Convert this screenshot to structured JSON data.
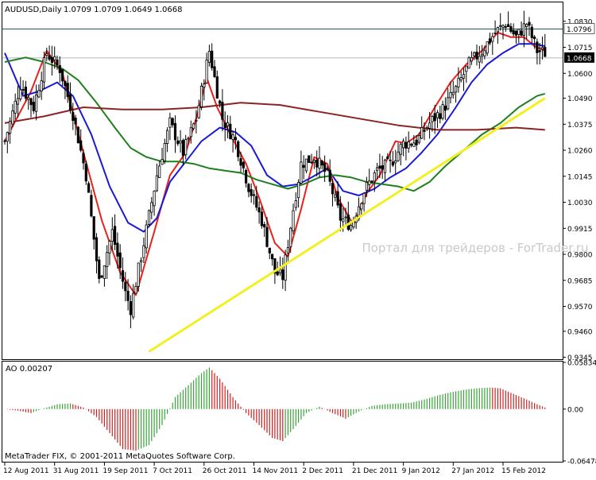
{
  "header": {
    "symbol": "AUDUSD,Daily",
    "ohlc": "1.0709 1.0709 1.0649 1.0668"
  },
  "watermark": "Портал для трейдеров - ForTrader.ru",
  "copyright": "MetaTrader FIX, © 2001-2011 MetaQuotes Software Corp.",
  "colors": {
    "candles": "#000000",
    "ma_red": "#e8211b",
    "ma_blue": "#1a1ad6",
    "ma_green": "#1e7f1e",
    "ma_brown": "#8b2323",
    "trendline": "#f2ef22",
    "ao_up": "#3aa33a",
    "ao_down": "#d11f1f",
    "level_line": "#1a5a5a",
    "watermark": "#c9c9c9"
  },
  "chart_data": [
    {
      "type": "candlestick",
      "instrument": "AUDUSD",
      "timeframe": "Daily",
      "ylim": [
        0.934,
        1.091
      ],
      "y_ticks": [
        "1.0830",
        "1.0715",
        "1.0600",
        "1.0490",
        "1.0375",
        "1.0260",
        "1.0145",
        "1.0030",
        "0.9915",
        "0.9800",
        "0.9685",
        "0.9570",
        "0.9460",
        "0.9345"
      ],
      "x_ticks": [
        "12 Aug 2011",
        "31 Aug 2011",
        "19 Sep 2011",
        "7 Oct 2011",
        "26 Oct 2011",
        "14 Nov 2011",
        "2 Dec 2011",
        "21 Dec 2011",
        "9 Jan 2012",
        "27 Jan 2012",
        "15 Feb 2012"
      ],
      "price_labels": {
        "level": "1.0796",
        "current": "1.0668"
      },
      "horizontal_level": 1.0796,
      "current_price": 1.0668,
      "close_path": [
        [
          0,
          1.03
        ],
        [
          6,
          1.055
        ],
        [
          11,
          1.045
        ],
        [
          16,
          1.069
        ],
        [
          21,
          1.062
        ],
        [
          26,
          1.042
        ],
        [
          31,
          1.015
        ],
        [
          36,
          0.968
        ],
        [
          41,
          0.99
        ],
        [
          46,
          0.963
        ],
        [
          48,
          0.956
        ],
        [
          53,
          0.985
        ],
        [
          58,
          1.015
        ],
        [
          63,
          1.038
        ],
        [
          68,
          1.025
        ],
        [
          73,
          1.04
        ],
        [
          78,
          1.07
        ],
        [
          83,
          1.04
        ],
        [
          88,
          1.03
        ],
        [
          93,
          1.01
        ],
        [
          98,
          0.995
        ],
        [
          103,
          0.972
        ],
        [
          106,
          0.97
        ],
        [
          110,
          1.0
        ],
        [
          113,
          1.02
        ],
        [
          118,
          1.023
        ],
        [
          123,
          1.015
        ],
        [
          128,
          0.996
        ],
        [
          132,
          0.993
        ],
        [
          137,
          1.008
        ],
        [
          142,
          1.017
        ],
        [
          147,
          1.02
        ],
        [
          152,
          1.029
        ],
        [
          157,
          1.03
        ],
        [
          162,
          1.038
        ],
        [
          167,
          1.044
        ],
        [
          172,
          1.053
        ],
        [
          177,
          1.064
        ],
        [
          182,
          1.07
        ],
        [
          187,
          1.078
        ],
        [
          191,
          1.082
        ],
        [
          195,
          1.076
        ],
        [
          199,
          1.082
        ],
        [
          203,
          1.07
        ],
        [
          206,
          1.069
        ]
      ],
      "series": [
        {
          "name": "",
          "color": "red",
          "points": [
            [
              0,
              1.03
            ],
            [
              10,
              1.052
            ],
            [
              16,
              1.07
            ],
            [
              22,
              1.06
            ],
            [
              30,
              1.025
            ],
            [
              37,
              0.995
            ],
            [
              44,
              0.972
            ],
            [
              50,
              0.962
            ],
            [
              57,
              0.99
            ],
            [
              63,
              1.015
            ],
            [
              69,
              1.025
            ],
            [
              73,
              1.04
            ],
            [
              77,
              1.058
            ],
            [
              81,
              1.045
            ],
            [
              86,
              1.033
            ],
            [
              92,
              1.02
            ],
            [
              97,
              1.005
            ],
            [
              103,
              0.985
            ],
            [
              108,
              0.979
            ],
            [
              113,
              1.0
            ],
            [
              118,
              1.023
            ],
            [
              123,
              1.02
            ],
            [
              127,
              1.005
            ],
            [
              133,
              0.993
            ],
            [
              138,
              1.007
            ],
            [
              143,
              1.015
            ],
            [
              149,
              1.03
            ],
            [
              153,
              1.029
            ],
            [
              158,
              1.033
            ],
            [
              164,
              1.045
            ],
            [
              170,
              1.056
            ],
            [
              176,
              1.064
            ],
            [
              182,
              1.07
            ],
            [
              188,
              1.078
            ],
            [
              193,
              1.076
            ],
            [
              198,
              1.076
            ],
            [
              202,
              1.072
            ],
            [
              206,
              1.07
            ]
          ]
        },
        {
          "name": "",
          "color": "blue",
          "points": [
            [
              0,
              1.069
            ],
            [
              7,
              1.05
            ],
            [
              13,
              1.052
            ],
            [
              20,
              1.056
            ],
            [
              26,
              1.05
            ],
            [
              33,
              1.033
            ],
            [
              40,
              1.01
            ],
            [
              47,
              0.994
            ],
            [
              53,
              0.99
            ],
            [
              58,
              0.996
            ],
            [
              63,
              1.012
            ],
            [
              69,
              1.021
            ],
            [
              75,
              1.03
            ],
            [
              82,
              1.036
            ],
            [
              88,
              1.034
            ],
            [
              94,
              1.028
            ],
            [
              100,
              1.015
            ],
            [
              106,
              1.01
            ],
            [
              112,
              1.011
            ],
            [
              117,
              1.014
            ],
            [
              123,
              1.018
            ],
            [
              129,
              1.008
            ],
            [
              135,
              1.006
            ],
            [
              141,
              1.009
            ],
            [
              147,
              1.014
            ],
            [
              153,
              1.018
            ],
            [
              159,
              1.025
            ],
            [
              165,
              1.033
            ],
            [
              172,
              1.045
            ],
            [
              178,
              1.056
            ],
            [
              184,
              1.064
            ],
            [
              190,
              1.069
            ],
            [
              196,
              1.073
            ],
            [
              202,
              1.073
            ],
            [
              206,
              1.072
            ]
          ]
        },
        {
          "name": "",
          "color": "green",
          "points": [
            [
              0,
              1.065
            ],
            [
              8,
              1.067
            ],
            [
              15,
              1.065
            ],
            [
              22,
              1.062
            ],
            [
              28,
              1.057
            ],
            [
              35,
              1.047
            ],
            [
              42,
              1.036
            ],
            [
              48,
              1.027
            ],
            [
              54,
              1.023
            ],
            [
              60,
              1.021
            ],
            [
              66,
              1.021
            ],
            [
              72,
              1.02
            ],
            [
              78,
              1.018
            ],
            [
              84,
              1.017
            ],
            [
              90,
              1.016
            ],
            [
              96,
              1.013
            ],
            [
              102,
              1.011
            ],
            [
              108,
              1.009
            ],
            [
              114,
              1.011
            ],
            [
              120,
              1.014
            ],
            [
              126,
              1.015
            ],
            [
              132,
              1.014
            ],
            [
              138,
              1.012
            ],
            [
              144,
              1.011
            ],
            [
              150,
              1.01
            ],
            [
              156,
              1.008
            ],
            [
              162,
              1.012
            ],
            [
              168,
              1.019
            ],
            [
              175,
              1.026
            ],
            [
              182,
              1.033
            ],
            [
              189,
              1.038
            ],
            [
              196,
              1.045
            ],
            [
              203,
              1.05
            ],
            [
              206,
              1.051
            ]
          ]
        },
        {
          "name": "",
          "color": "brown",
          "points": [
            [
              0,
              1.038
            ],
            [
              15,
              1.041
            ],
            [
              30,
              1.045
            ],
            [
              45,
              1.044
            ],
            [
              60,
              1.044
            ],
            [
              75,
              1.045
            ],
            [
              90,
              1.047
            ],
            [
              105,
              1.046
            ],
            [
              120,
              1.043
            ],
            [
              135,
              1.04
            ],
            [
              150,
              1.037
            ],
            [
              165,
              1.035
            ],
            [
              180,
              1.035
            ],
            [
              195,
              1.036
            ],
            [
              206,
              1.035
            ]
          ]
        }
      ],
      "trendline": [
        [
          55,
          0.937
        ],
        [
          206,
          1.049
        ]
      ]
    },
    {
      "type": "bar",
      "indicator": "AO",
      "title": "AO 0.00207",
      "ylim": [
        -0.06478,
        0.05834
      ],
      "y_ticks": [
        "0.05834",
        "0.00",
        "-0.06478"
      ],
      "current_value": 0.00207,
      "path": [
        [
          0,
          0.0
        ],
        [
          5,
          -0.002
        ],
        [
          10,
          -0.005
        ],
        [
          15,
          0.001
        ],
        [
          20,
          0.006
        ],
        [
          25,
          0.007
        ],
        [
          30,
          0.002
        ],
        [
          35,
          -0.01
        ],
        [
          40,
          -0.03
        ],
        [
          45,
          -0.05
        ],
        [
          50,
          -0.052
        ],
        [
          55,
          -0.045
        ],
        [
          60,
          -0.02
        ],
        [
          65,
          0.015
        ],
        [
          70,
          0.03
        ],
        [
          75,
          0.045
        ],
        [
          78,
          0.052
        ],
        [
          82,
          0.038
        ],
        [
          87,
          0.015
        ],
        [
          92,
          -0.005
        ],
        [
          97,
          -0.02
        ],
        [
          102,
          -0.036
        ],
        [
          106,
          -0.04
        ],
        [
          110,
          -0.025
        ],
        [
          115,
          -0.005
        ],
        [
          120,
          0.003
        ],
        [
          125,
          -0.005
        ],
        [
          130,
          -0.012
        ],
        [
          135,
          -0.003
        ],
        [
          140,
          0.004
        ],
        [
          145,
          0.006
        ],
        [
          150,
          0.007
        ],
        [
          155,
          0.008
        ],
        [
          160,
          0.012
        ],
        [
          165,
          0.017
        ],
        [
          170,
          0.021
        ],
        [
          175,
          0.024
        ],
        [
          180,
          0.026
        ],
        [
          185,
          0.027
        ],
        [
          189,
          0.026
        ],
        [
          194,
          0.019
        ],
        [
          199,
          0.012
        ],
        [
          203,
          0.006
        ],
        [
          206,
          0.002
        ]
      ]
    }
  ]
}
